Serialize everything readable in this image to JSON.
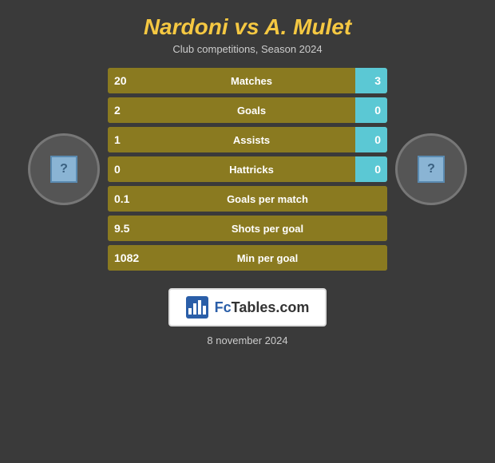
{
  "header": {
    "title": "Nardoni vs A. Mulet",
    "subtitle": "Club competitions, Season 2024"
  },
  "stats": [
    {
      "id": "matches",
      "label": "Matches",
      "left_val": "20",
      "right_val": "3",
      "has_right": true
    },
    {
      "id": "goals",
      "label": "Goals",
      "left_val": "2",
      "right_val": "0",
      "has_right": true
    },
    {
      "id": "assists",
      "label": "Assists",
      "left_val": "1",
      "right_val": "0",
      "has_right": true
    },
    {
      "id": "hattricks",
      "label": "Hattricks",
      "left_val": "0",
      "right_val": "0",
      "has_right": true
    },
    {
      "id": "goals-per-match",
      "label": "Goals per match",
      "left_val": "0.1",
      "has_right": false
    },
    {
      "id": "shots-per-goal",
      "label": "Shots per goal",
      "left_val": "9.5",
      "has_right": false
    },
    {
      "id": "min-per-goal",
      "label": "Min per goal",
      "left_val": "1082",
      "has_right": false
    }
  ],
  "logo": {
    "text": "FcTables.com"
  },
  "date": "8 november 2024",
  "avatars": {
    "left_alt": "Nardoni player photo",
    "right_alt": "A. Mulet player photo"
  }
}
